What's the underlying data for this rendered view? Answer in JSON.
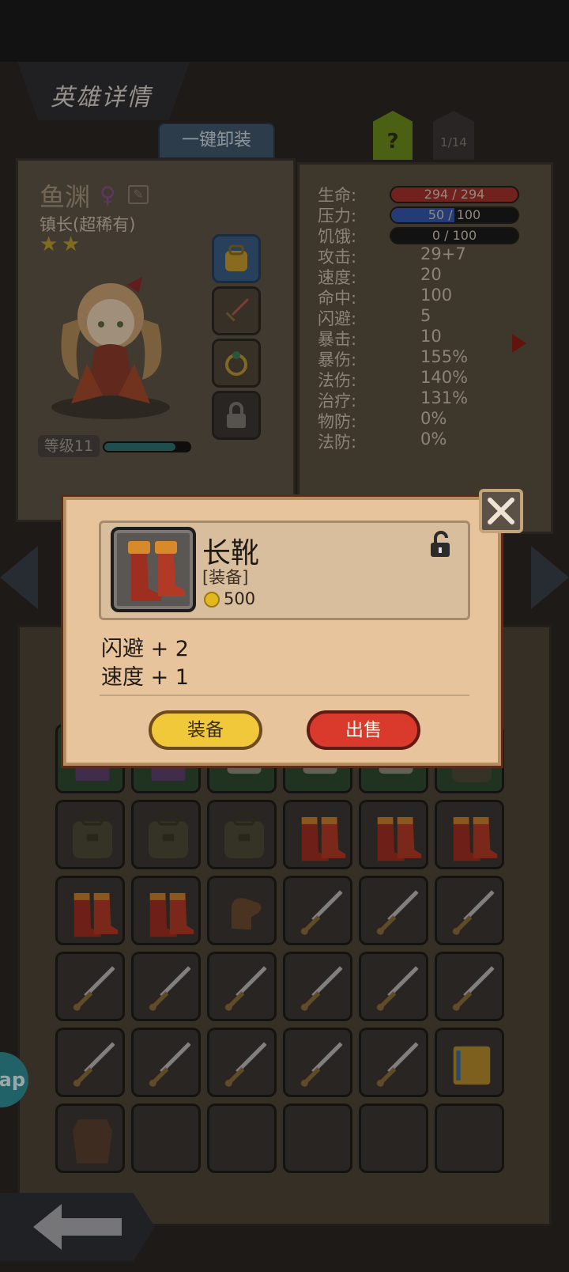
{
  "header": {
    "title": "英雄详情"
  },
  "toolbar": {
    "unequip_all_label": "一键卸装",
    "help_label": "?",
    "page_indicator": "1/14"
  },
  "hero": {
    "name": "鱼渊",
    "gender_icon": "female-icon",
    "class": "镇长(超稀有)",
    "stars": 2,
    "level_label": "等级11",
    "exp_fraction": 0.8,
    "equip_slots": [
      "backpack-icon",
      "sword-icon",
      "ring-icon",
      "lock-icon"
    ]
  },
  "stats": {
    "hp_label": "生命:",
    "hp_value": "294 / 294",
    "hp_fraction": 1.0,
    "stress_label": "压力:",
    "stress_value": "50 / 100",
    "stress_fraction": 0.5,
    "hunger_label": "饥饿:",
    "hunger_value": "0 / 100",
    "hunger_fraction": 0.0,
    "rows": [
      {
        "label": "攻击:",
        "value": "29+7"
      },
      {
        "label": "速度:",
        "value": "20"
      },
      {
        "label": "命中:",
        "value": "100"
      },
      {
        "label": "闪避:",
        "value": "5"
      },
      {
        "label": "暴击:",
        "value": "10"
      },
      {
        "label": "暴伤:",
        "value": "155%"
      },
      {
        "label": "法伤:",
        "value": "140%"
      },
      {
        "label": "治疗:",
        "value": "131%"
      },
      {
        "label": "物防:",
        "value": "0%"
      },
      {
        "label": "法防:",
        "value": "0%"
      }
    ]
  },
  "modal": {
    "item_name": "长靴",
    "item_type": "[装备]",
    "price": "500",
    "effects": [
      "闪避 + 2",
      "速度 + 1"
    ],
    "equip_label": "装备",
    "sell_label": "出售"
  },
  "inventory": {
    "rows": [
      [
        "book-icon",
        "book-icon",
        "scroll-icon",
        "scroll-icon",
        "scroll-icon",
        "backpack-icon"
      ],
      [
        "backpack-icon",
        "backpack-icon",
        "backpack-icon",
        "boots-icon",
        "boots-icon",
        "boots-icon"
      ],
      [
        "boots-icon",
        "boots-icon",
        "glove-icon",
        "sword-icon",
        "sword-icon",
        "sword-icon"
      ],
      [
        "sword-icon",
        "sword-icon",
        "sword-icon",
        "sword-icon",
        "sword-icon",
        "sword-icon"
      ],
      [
        "sword-icon",
        "sword-icon",
        "sword-icon",
        "sword-icon",
        "sword-icon",
        "tome-icon"
      ],
      [
        "armor-icon",
        "empty",
        "empty",
        "empty",
        "empty",
        "empty"
      ]
    ]
  },
  "app_bubble": {
    "label": "ap"
  },
  "colors": {
    "hp": "#a3302c",
    "stress": "#3555a8",
    "equip_button": "#f0c83a",
    "sell_button": "#d93a2b"
  }
}
